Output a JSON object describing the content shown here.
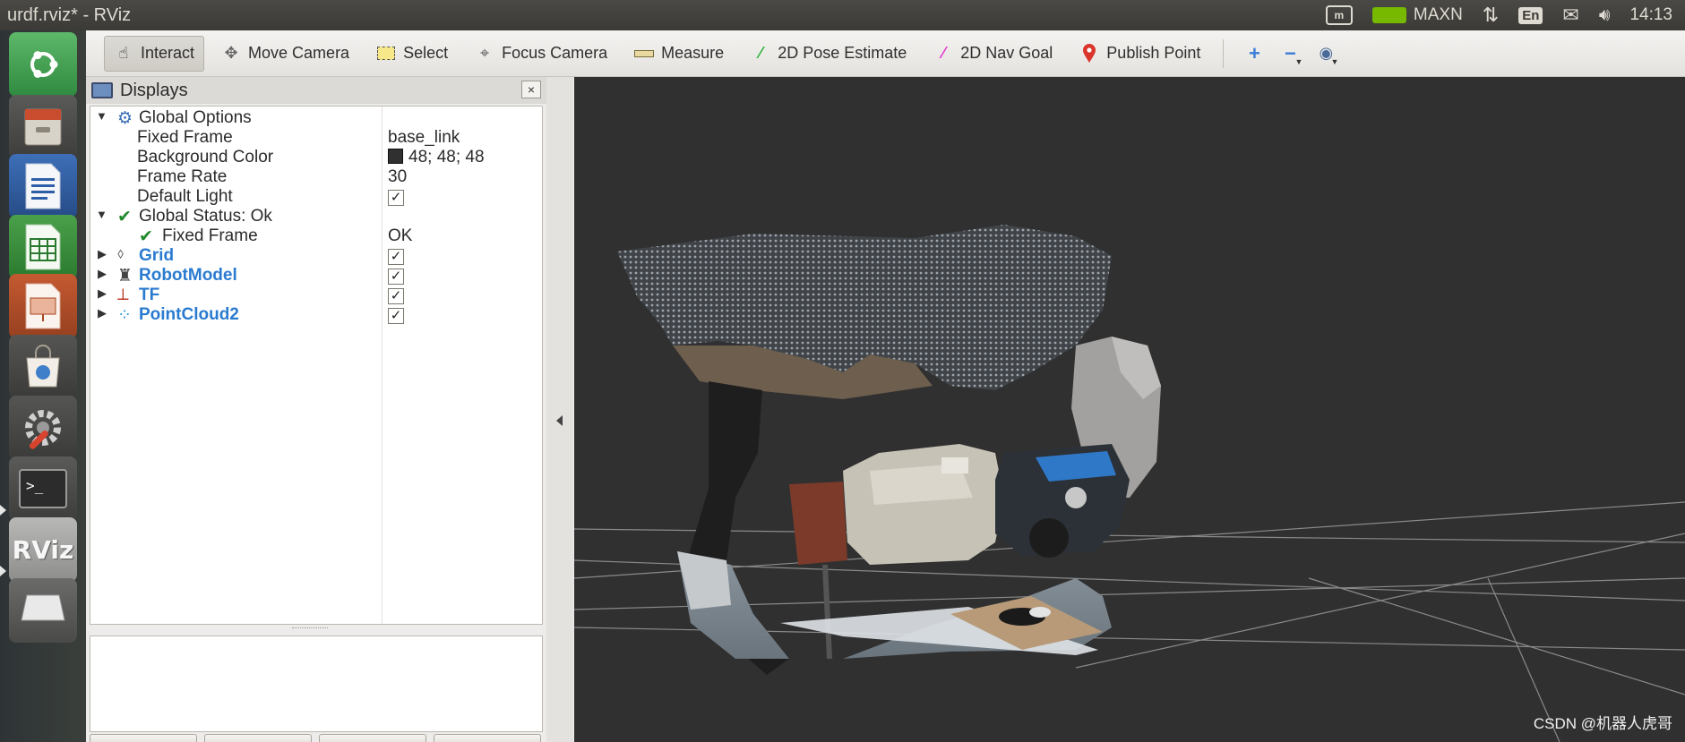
{
  "window": {
    "title": "urdf.rviz* - RViz"
  },
  "system_indicators": {
    "power_mode": "MAXN",
    "keyboard_layout": "En",
    "clock": "14:13"
  },
  "launcher": {
    "items": [
      {
        "name": "Ubuntu Dash",
        "icon": "ubuntu-logo-icon"
      },
      {
        "name": "Files",
        "icon": "file-cabinet-icon"
      },
      {
        "name": "LibreOffice Writer",
        "icon": "writer-document-icon"
      },
      {
        "name": "LibreOffice Calc",
        "icon": "calc-spreadsheet-icon"
      },
      {
        "name": "LibreOffice Impress",
        "icon": "impress-presentation-icon"
      },
      {
        "name": "Ubuntu Software",
        "icon": "shopping-bag-icon"
      },
      {
        "name": "System Settings",
        "icon": "settings-wrench-icon"
      },
      {
        "name": "Terminal",
        "icon": "terminal-icon"
      },
      {
        "name": "RViz",
        "icon": "rviz-icon",
        "label": "RViz"
      },
      {
        "name": "Drive",
        "icon": "drive-icon"
      }
    ]
  },
  "toolbar": {
    "tools": [
      {
        "label": "Interact",
        "icon": "hand-cursor-icon",
        "active": true
      },
      {
        "label": "Move Camera",
        "icon": "move-camera-icon",
        "active": false
      },
      {
        "label": "Select",
        "icon": "select-box-icon",
        "active": false
      },
      {
        "label": "Focus Camera",
        "icon": "focus-crosshair-icon",
        "active": false
      },
      {
        "label": "Measure",
        "icon": "ruler-icon",
        "active": false
      },
      {
        "label": "2D Pose Estimate",
        "icon": "green-arrow-icon",
        "active": false
      },
      {
        "label": "2D Nav Goal",
        "icon": "pink-arrow-icon",
        "active": false
      },
      {
        "label": "Publish Point",
        "icon": "map-pin-icon",
        "active": false
      }
    ]
  },
  "displays_panel": {
    "title": "Displays",
    "close_glyph": "×",
    "rows": {
      "global_options": "Global Options",
      "fixed_frame_label": "Fixed Frame",
      "fixed_frame_value": "base_link",
      "background_color_label": "Background Color",
      "background_color_value": "48; 48; 48",
      "frame_rate_label": "Frame Rate",
      "frame_rate_value": "30",
      "default_light_label": "Default Light",
      "default_light_checked": true,
      "global_status": "Global Status: Ok",
      "status_fixed_frame_label": "Fixed Frame",
      "status_fixed_frame_value": "OK",
      "grid": "Grid",
      "robot_model": "RobotModel",
      "tf": "TF",
      "pointcloud2": "PointCloud2"
    },
    "check_glyph": "✓"
  },
  "viewport": {
    "background_color": "#303030",
    "watermark": "CSDN @机器人虎哥"
  }
}
